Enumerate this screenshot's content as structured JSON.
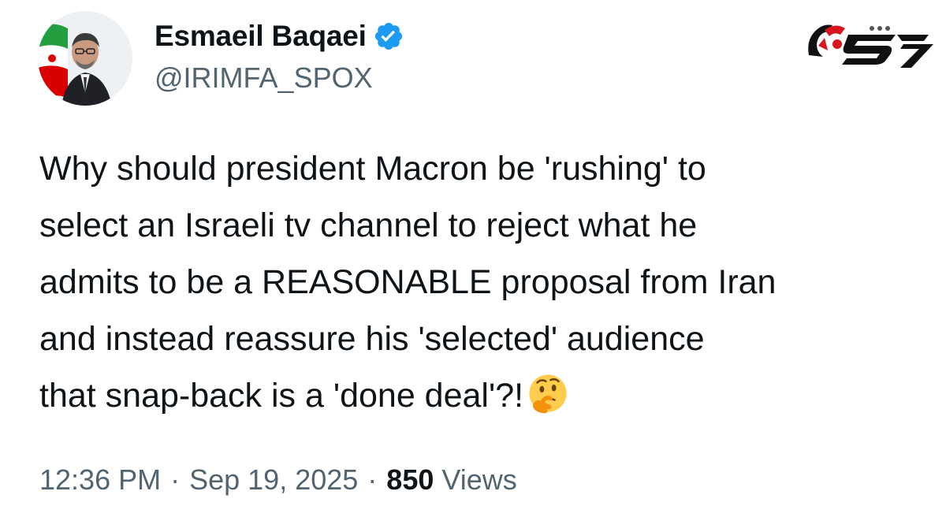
{
  "author": {
    "name": "Esmaeil Baqaei",
    "handle": "@IRIMFA_SPOX",
    "verified": true,
    "avatar_icon": "profile-photo-with-iran-flag"
  },
  "tweet": {
    "lines": [
      "Why should president Macron be 'rushing' to",
      "select an Israeli tv channel to reject what he",
      "admits to be a REASONABLE proposal from Iran",
      "and instead reassure his 'selected' audience",
      "that snap-back is a 'done deal'?!"
    ],
    "trailing_emoji": "thinking-face-emoji"
  },
  "meta": {
    "time": "12:36 PM",
    "separator": "·",
    "date": "Sep 19, 2025",
    "views_count": "850",
    "views_label": "Views"
  },
  "branding": {
    "logo_icon": "rokna-logo",
    "logo_colors": [
      "#d7161f",
      "#111111"
    ]
  },
  "colors": {
    "text_primary": "#0f1419",
    "text_secondary": "#536471",
    "verified_blue": "#1d9bf0",
    "background": "#ffffff"
  }
}
